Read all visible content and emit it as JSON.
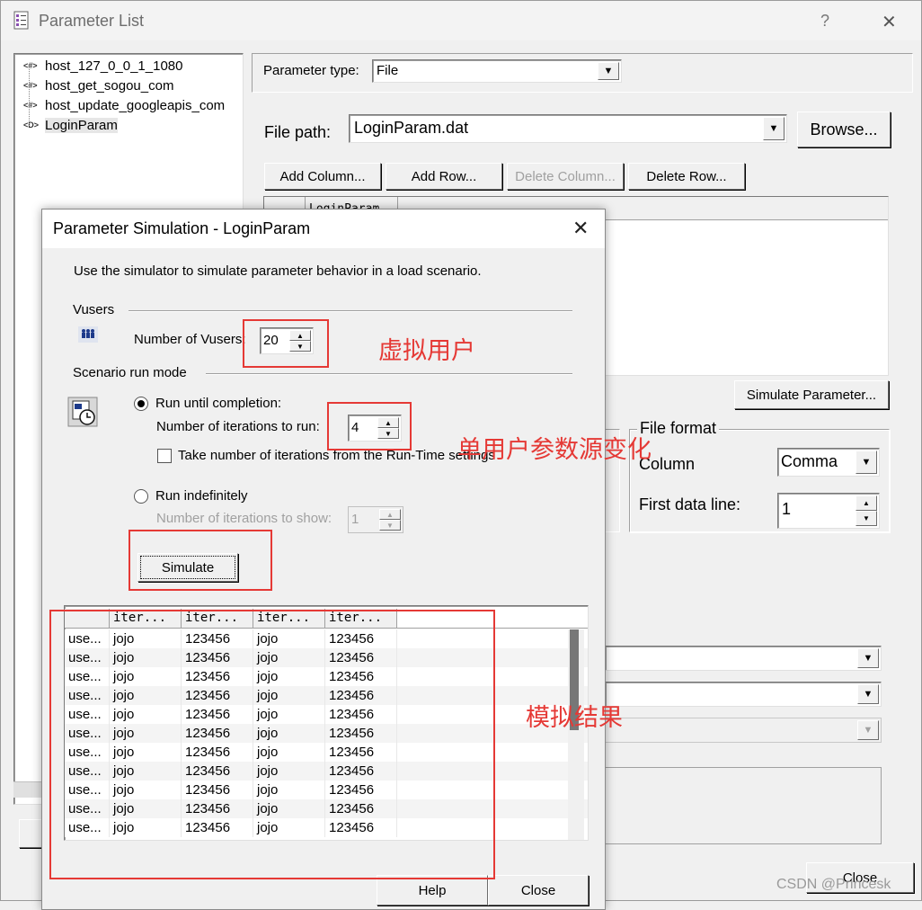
{
  "outer_window": {
    "title": "Parameter List",
    "help_glyph": "?",
    "close_glyph": "✕"
  },
  "tree": {
    "items": [
      {
        "icon": "<#>",
        "label": "host_127_0_0_1_1080"
      },
      {
        "icon": "<#>",
        "label": "host_get_sogou_com"
      },
      {
        "icon": "<#>",
        "label": "host_update_googleapis_com"
      },
      {
        "icon": "<D>",
        "label": "LoginParam"
      }
    ]
  },
  "param_type": {
    "label": "Parameter type:",
    "value": "File"
  },
  "file_path": {
    "label": "File path:",
    "value": "LoginParam.dat",
    "browse": "Browse..."
  },
  "toolbar": {
    "add_column": "Add Column...",
    "add_row": "Add Row...",
    "delete_column": "Delete Column...",
    "delete_row": "Delete Row..."
  },
  "param_table": {
    "header": "LoginParam"
  },
  "simulate_parameter": "Simulate Parameter...",
  "file_format": {
    "title": "File format",
    "column_label": "Column",
    "column_value": "Comma",
    "first_line_label": "First data line:",
    "first_line_value": "1"
  },
  "bottom_close": "Close",
  "dialog": {
    "title": "Parameter Simulation - LoginParam",
    "description": "Use the simulator to simulate parameter behavior in a load scenario.",
    "vusers_section": "Vusers",
    "vusers_label": "Number of Vusers:",
    "vusers_value": "20",
    "scenario_section": "Scenario run mode",
    "run_until": "Run until completion:",
    "iterations_label": "Number of iterations to run:",
    "iterations_value": "4",
    "take_runtime": "Take number of iterations from the Run-Time settings",
    "run_indef": "Run indefinitely",
    "show_label": "Number of iterations to show:",
    "show_value": "1",
    "simulate": "Simulate",
    "help": "Help",
    "close": "Close"
  },
  "results": {
    "headers": [
      "",
      "iter...",
      "iter...",
      "iter...",
      "iter..."
    ],
    "rows": [
      [
        "use...",
        "jojo",
        "123456",
        "jojo",
        "123456"
      ],
      [
        "use...",
        "jojo",
        "123456",
        "jojo",
        "123456"
      ],
      [
        "use...",
        "jojo",
        "123456",
        "jojo",
        "123456"
      ],
      [
        "use...",
        "jojo",
        "123456",
        "jojo",
        "123456"
      ],
      [
        "use...",
        "jojo",
        "123456",
        "jojo",
        "123456"
      ],
      [
        "use...",
        "jojo",
        "123456",
        "jojo",
        "123456"
      ],
      [
        "use...",
        "jojo",
        "123456",
        "jojo",
        "123456"
      ],
      [
        "use...",
        "jojo",
        "123456",
        "jojo",
        "123456"
      ],
      [
        "use...",
        "jojo",
        "123456",
        "jojo",
        "123456"
      ],
      [
        "use...",
        "jojo",
        "123456",
        "jojo",
        "123456"
      ],
      [
        "use...",
        "jojo",
        "123456",
        "jojo",
        "123456"
      ]
    ]
  },
  "annotations": {
    "vusers": "虚拟用户",
    "iterations": "单用户参数源变化",
    "results": "模拟结果"
  },
  "watermark": "CSDN @Princesk",
  "colors": {
    "annotation": "#e53935"
  }
}
